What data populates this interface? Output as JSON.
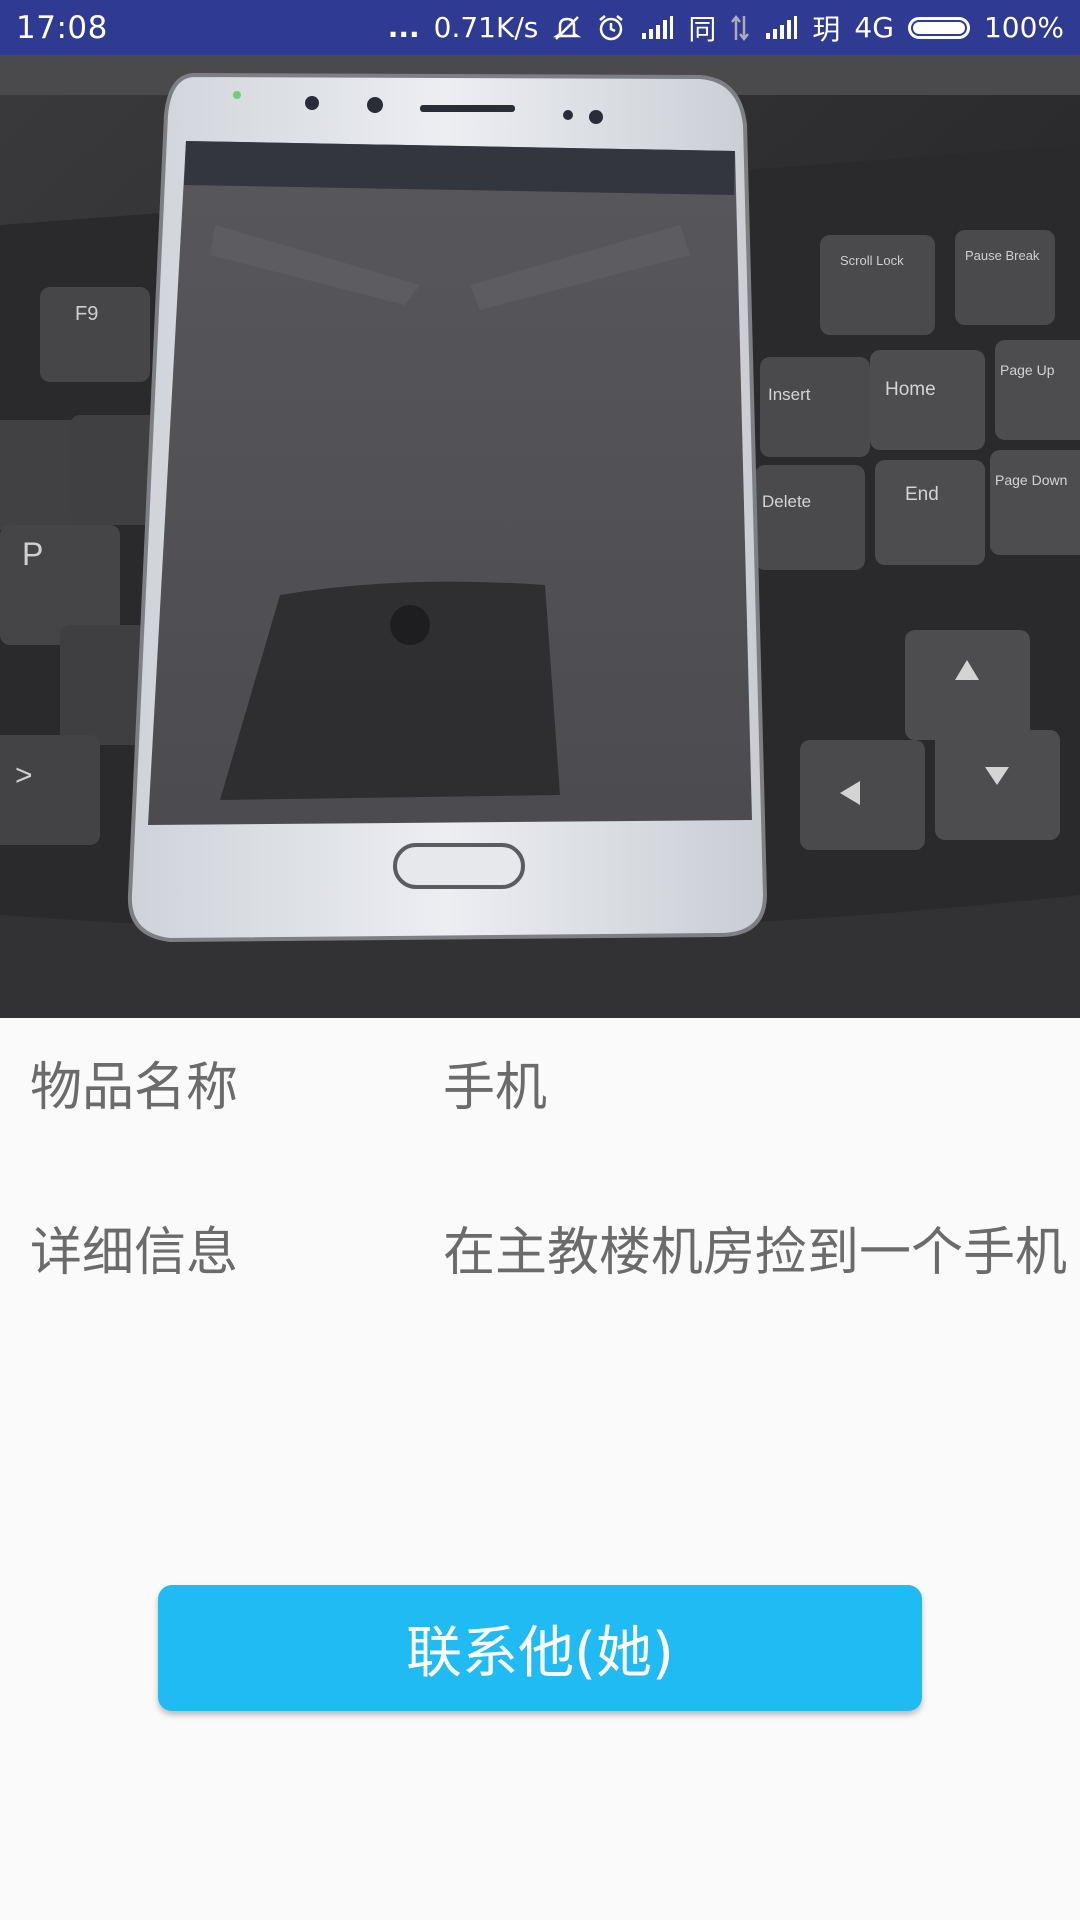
{
  "status_bar": {
    "time": "17:08",
    "dots": "...",
    "net_speed": "0.71K/s",
    "sim1_label": "同",
    "sim2_label": "玥",
    "network_type": "4G",
    "battery_percent": "100%",
    "battery_level": 1.0,
    "icons": [
      "mute-icon",
      "alarm-icon",
      "signal-icon",
      "data-transfer-icon",
      "signal-icon",
      "battery-icon"
    ]
  },
  "photo": {
    "subject": "phone-on-keyboard-photo",
    "key_labels": {
      "f9": "F9",
      "p": "P",
      "insert": "Insert",
      "home": "Home",
      "page_up": "Page Up",
      "delete": "Delete",
      "end": "End",
      "page_down": "Page Down",
      "scroll_lock": "Scroll Lock",
      "pause_break": "Pause Break"
    }
  },
  "details": {
    "name_label": "物品名称",
    "name_value": "手机",
    "info_label": "详细信息",
    "info_value": "在主教楼机房捡到一个手机"
  },
  "actions": {
    "contact_label": "联系他(她)"
  },
  "colors": {
    "status_bar": "#2f3a92",
    "button": "#1fbbf2",
    "text": "#6b6b6b",
    "background": "#fafafa"
  }
}
